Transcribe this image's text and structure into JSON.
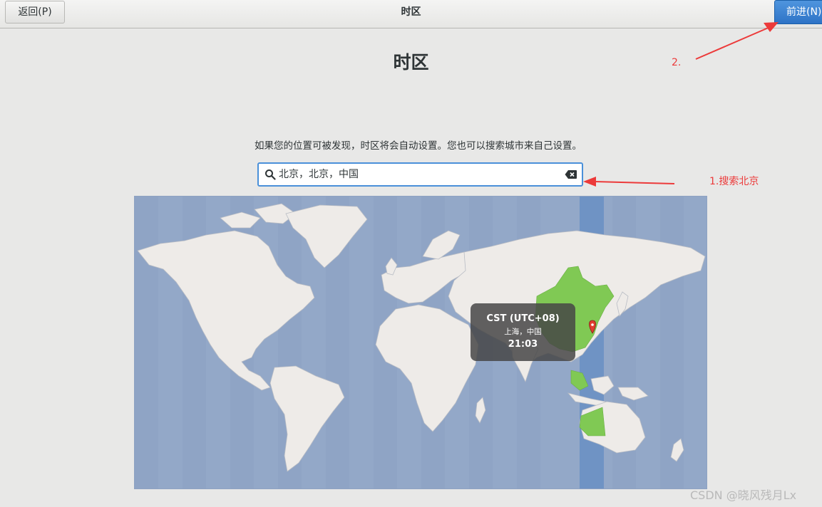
{
  "header": {
    "back_label": "返回(P)",
    "title": "时区",
    "next_label": "前进(N)"
  },
  "page": {
    "title": "时区",
    "description": "如果您的位置可被发现，时区将会自动设置。您也可以搜索城市来自己设置。"
  },
  "search": {
    "value": "北京，北京，中国",
    "icon": "search-icon",
    "clear_icon": "clear-icon"
  },
  "map": {
    "selected_timezone": "CST (UTC+08)",
    "selected_city": "上海，中国",
    "local_time": "21:03",
    "colors": {
      "ocean": "#93a8c8",
      "land": "#eeebe8",
      "selected_country": "#80c954",
      "selected_band": "#6f93c4",
      "pin": "#e03c31"
    }
  },
  "annotations": {
    "step1": "1.搜索北京",
    "step2": "2.",
    "color": "#ec3a3a"
  },
  "watermark": "CSDN @晓风残月Lx"
}
